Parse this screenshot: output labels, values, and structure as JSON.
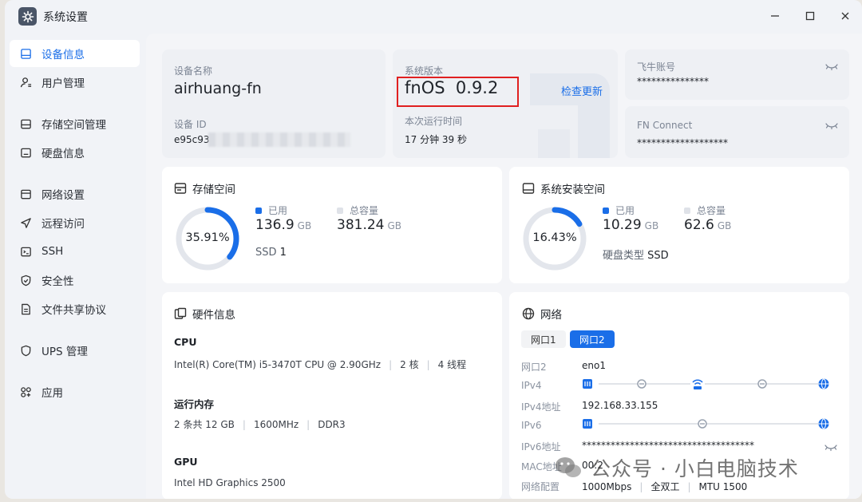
{
  "window": {
    "title": "系统设置",
    "minimize_label": "—",
    "maximize_label": "□",
    "close_label": "×"
  },
  "sidebar": {
    "items": [
      {
        "label": "设备信息",
        "icon": "device-info-icon",
        "active": true
      },
      {
        "label": "用户管理",
        "icon": "user-icon"
      },
      {
        "label": "存储空间管理",
        "icon": "storage-icon"
      },
      {
        "label": "硬盘信息",
        "icon": "disk-icon"
      },
      {
        "label": "网络设置",
        "icon": "network-icon"
      },
      {
        "label": "远程访问",
        "icon": "remote-icon"
      },
      {
        "label": "SSH",
        "icon": "ssh-icon"
      },
      {
        "label": "安全性",
        "icon": "shield-icon"
      },
      {
        "label": "文件共享协议",
        "icon": "file-share-icon"
      },
      {
        "label": "UPS 管理",
        "icon": "ups-icon"
      },
      {
        "label": "应用",
        "icon": "apps-icon"
      }
    ]
  },
  "device": {
    "name_label": "设备名称",
    "name": "airhuang-fn",
    "id_label": "设备 ID",
    "id_visible": "e95c93"
  },
  "system": {
    "version_label": "系统版本",
    "version": "fnOS  0.9.2",
    "check_update": "检查更新",
    "uptime_label": "本次运行时间",
    "uptime": "17 分钟 39 秒"
  },
  "account": {
    "feiniu_label": "飞牛账号",
    "feiniu_value": "***************",
    "fn_connect_label": "FN Connect",
    "fn_connect_value": "*******************"
  },
  "storage": {
    "title": "存储空间",
    "percent": "35.91%",
    "percent_value": 35.91,
    "used_label": "已用",
    "used_value": "136.9",
    "used_unit": "GB",
    "total_label": "总容量",
    "total_value": "381.24",
    "total_unit": "GB",
    "disk_type": "SSD",
    "disk_count": "1"
  },
  "system_space": {
    "title": "系统安装空间",
    "percent": "16.43%",
    "percent_value": 16.43,
    "used_label": "已用",
    "used_value": "10.29",
    "used_unit": "GB",
    "total_label": "总容量",
    "total_value": "62.6",
    "total_unit": "GB",
    "disk_type_label": "硬盘类型",
    "disk_type": "SSD"
  },
  "hardware": {
    "title": "硬件信息",
    "cpu_label": "CPU",
    "cpu_model": "Intel(R) Core(TM) i5-3470T CPU @ 2.90GHz",
    "cpu_cores": "2 核",
    "cpu_threads": "4 线程",
    "mem_label": "运行内存",
    "mem_size": "2 条共 12 GB",
    "mem_freq": "1600MHz",
    "mem_type": "DDR3",
    "gpu_label": "GPU",
    "gpu_model": "Intel HD Graphics 2500"
  },
  "network": {
    "title": "网络",
    "tabs": [
      "网口1",
      "网口2"
    ],
    "active_tab": 1,
    "rows": {
      "port_label": "网口2",
      "port_value": "eno1",
      "ipv4_label": "IPv4",
      "ipv4_addr_label": "IPv4地址",
      "ipv4_addr": "192.168.33.155",
      "ipv6_label": "IPv6",
      "ipv6_addr_label": "IPv6地址",
      "ipv6_addr": "************************************",
      "mac_label": "MAC地址",
      "mac_value": "00:2",
      "config_label": "网络配置",
      "speed": "1000Mbps",
      "duplex": "全双工",
      "mtu": "MTU 1500"
    }
  },
  "watermark": {
    "text": "公众号 · 小白电脑技术"
  },
  "colors": {
    "accent": "#1a6ee8",
    "highlight_box": "#e02020",
    "ring_track": "#e3e6ec"
  }
}
